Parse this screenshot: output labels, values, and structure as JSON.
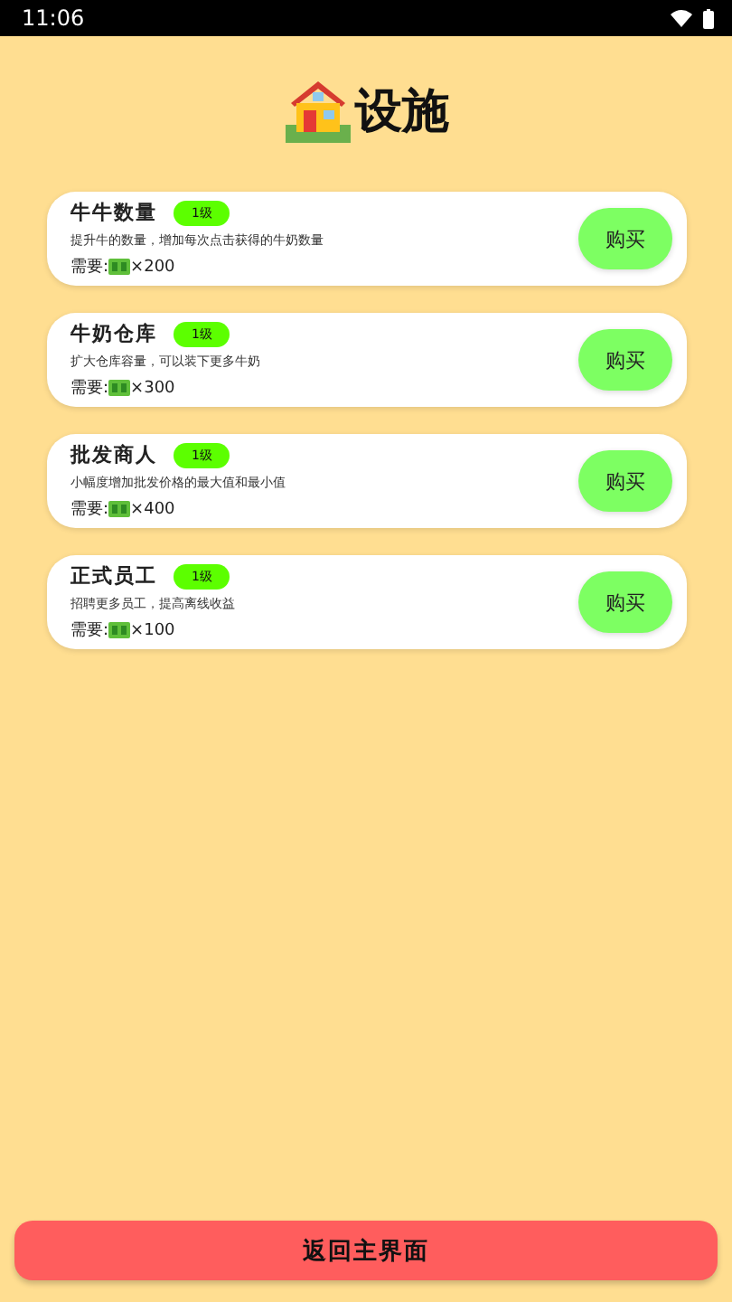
{
  "status_bar": {
    "time": "11:06"
  },
  "title": "设施",
  "facilities": [
    {
      "name": "牛牛数量",
      "level_badge": "1级",
      "description": "提升牛的数量，增加每次点击获得的牛奶数量",
      "cost_label": "需要:",
      "cost_amount": "×200",
      "button": "购买"
    },
    {
      "name": "牛奶仓库",
      "level_badge": "1级",
      "description": "扩大仓库容量，可以装下更多牛奶",
      "cost_label": "需要:",
      "cost_amount": "×300",
      "button": "购买"
    },
    {
      "name": "批发商人",
      "level_badge": "1级",
      "description": "小幅度增加批发价格的最大值和最小值",
      "cost_label": "需要:",
      "cost_amount": "×400",
      "button": "购买"
    },
    {
      "name": "正式员工",
      "level_badge": "1级",
      "description": "招聘更多员工，提高离线收益",
      "cost_label": "需要:",
      "cost_amount": "×100",
      "button": "购买"
    }
  ],
  "back_button": "返回主界面"
}
